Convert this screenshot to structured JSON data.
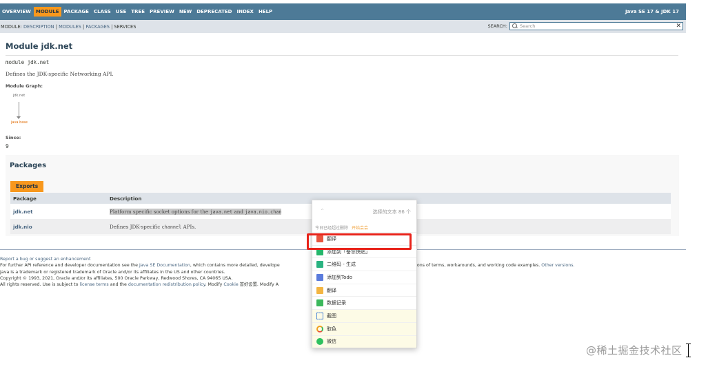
{
  "nav": {
    "items": [
      "OVERVIEW",
      "MODULE",
      "PACKAGE",
      "CLASS",
      "USE",
      "TREE",
      "PREVIEW",
      "NEW",
      "DEPRECATED",
      "INDEX",
      "HELP"
    ],
    "active": "MODULE",
    "brand": "Java SE 17 & JDK 17"
  },
  "subnav": {
    "prefix": "MODULE:",
    "description": "DESCRIPTION",
    "sep1": "|",
    "modules": "MODULES",
    "sep2": "|",
    "packages": "PACKAGES",
    "sep3": "|",
    "services": "SERVICES",
    "search_label": "SEARCH:",
    "search_placeholder": "Search",
    "clear_glyph": "✕"
  },
  "header": {
    "title": "Module jdk.net",
    "declaration": "module jdk.net",
    "description": "Defines the JDK-specific Networking API."
  },
  "graph": {
    "label": "Module Graph:",
    "node_top": "jdk.net",
    "node_bottom": "java.base"
  },
  "since": {
    "label": "Since:",
    "value": "9"
  },
  "packages": {
    "heading": "Packages",
    "tab": "Exports",
    "col_package": "Package",
    "col_description": "Description",
    "rows": [
      {
        "name": "jdk.net",
        "d1": "Platform specific socket options for the ",
        "c1": "java.net",
        "d2": " and ",
        "c2": "java.nio.chan"
      },
      {
        "name": "jdk.nio",
        "d1": "Defines JDK-specific ",
        "c1": "channel",
        "d2": " APIs.",
        "c2": ""
      }
    ]
  },
  "footer": {
    "l1": "Report a bug or suggest an enhancement",
    "l2a": "For further API reference and developer documentation see the ",
    "l2b": "Java SE Documentation",
    "l2c": ", which contains more detailed, develope",
    "l2d": "rviews, definitions of terms, workarounds, and working code examples. ",
    "l2e": "Other versions.",
    "l3": "Java is a trademark or registered trademark of Oracle and/or its affiliates in the US and other countries.",
    "l4": "Copyright © 1993, 2021, Oracle and/or its affiliates, 500 Oracle Parkway, Redwood Shores, CA 94065 USA.",
    "l5a": "All rights reserved. Use is subject to ",
    "l5b": "license terms",
    "l5c": " and the ",
    "l5d": "documentation redistribution policy",
    "l5e": ". Modify ",
    "l5f": "Cookie",
    "l5g": " 首好设置. Modify A"
  },
  "popup": {
    "caret": "^",
    "selected_count": "选择的文本 86 个",
    "today_label": "今日已经超过删除",
    "switch_label": "开始会会",
    "items": [
      {
        "label": "翻译",
        "icon": "translate-icon"
      },
      {
        "label": "添加到「备忘快贴」",
        "icon": "note-icon"
      },
      {
        "label": "二维码 - 生成",
        "icon": "qrcode-icon"
      },
      {
        "label": "添加到Todo",
        "icon": "todo-icon"
      },
      {
        "label": "翻译",
        "icon": "translate-alt-icon"
      },
      {
        "label": "数据记录",
        "icon": "record-icon"
      },
      {
        "label": "截图",
        "icon": "screenshot-icon"
      },
      {
        "label": "取色",
        "icon": "color-picker-icon"
      },
      {
        "label": "微信",
        "icon": "wechat-icon"
      }
    ]
  },
  "watermark": "@稀土掘金技术社区",
  "colors": {
    "nav_bg": "#4d7a97",
    "nav_active": "#f8981d",
    "subnav_bg": "#dee3e9",
    "link": "#4a6782",
    "highlight_box": "#e8231a"
  }
}
